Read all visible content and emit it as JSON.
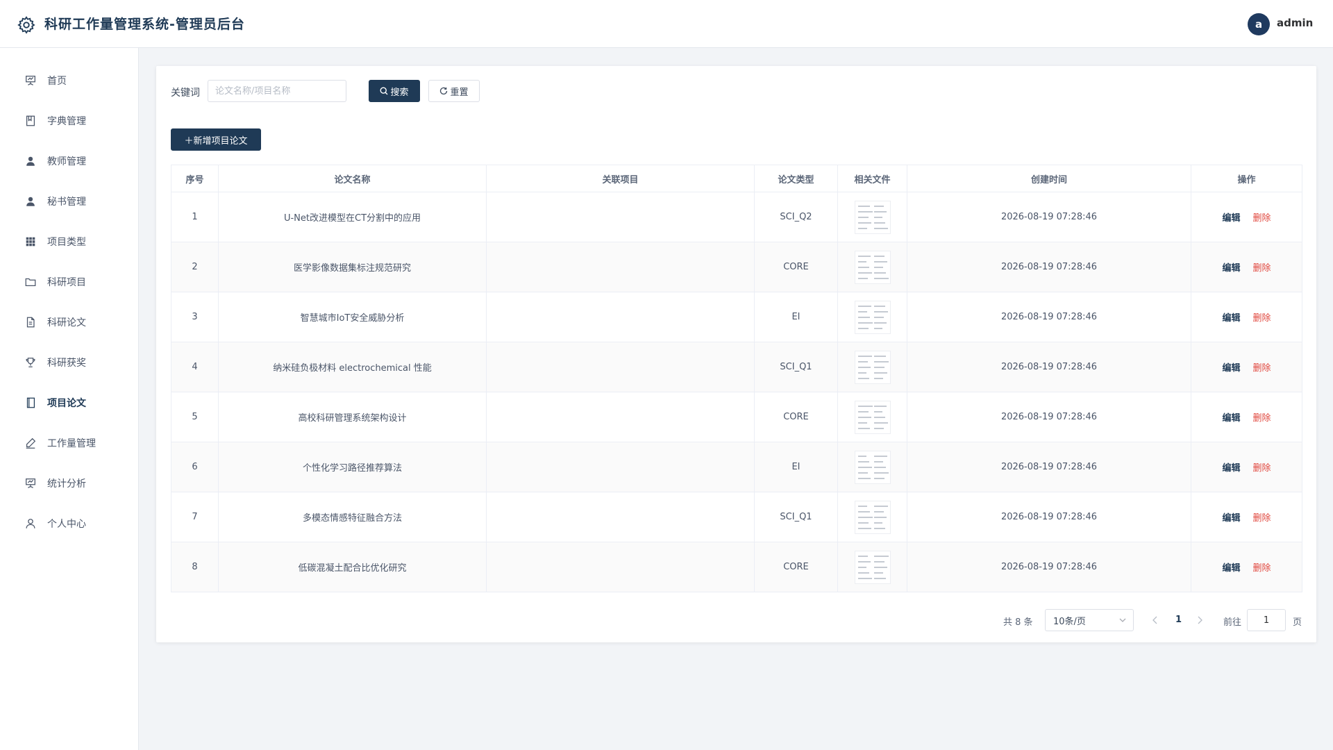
{
  "app": {
    "title": "科研工作量管理系统-管理员后台"
  },
  "user": {
    "avatar_letter": "a",
    "name": "admin"
  },
  "sidebar": {
    "items": [
      {
        "label": "首页",
        "icon": "presentation-icon"
      },
      {
        "label": "字典管理",
        "icon": "book-icon"
      },
      {
        "label": "教师管理",
        "icon": "user-icon"
      },
      {
        "label": "秘书管理",
        "icon": "user-icon"
      },
      {
        "label": "项目类型",
        "icon": "grid-icon"
      },
      {
        "label": "科研项目",
        "icon": "folder-icon"
      },
      {
        "label": "科研论文",
        "icon": "document-icon"
      },
      {
        "label": "科研获奖",
        "icon": "trophy-icon"
      },
      {
        "label": "项目论文",
        "icon": "notebook-icon",
        "active": true
      },
      {
        "label": "工作量管理",
        "icon": "pen-icon"
      },
      {
        "label": "统计分析",
        "icon": "presentation-icon"
      },
      {
        "label": "个人中心",
        "icon": "person-outline-icon"
      }
    ]
  },
  "search": {
    "label": "关键词",
    "placeholder": "论文名称/项目名称",
    "value": "",
    "search_button": "搜索",
    "reset_button": "重置"
  },
  "toolbar": {
    "add_button": "＋新增项目论文"
  },
  "table": {
    "headers": [
      "序号",
      "论文名称",
      "关联项目",
      "论文类型",
      "相关文件",
      "创建时间",
      "操作"
    ],
    "edit_label": "编辑",
    "delete_label": "删除",
    "rows": [
      {
        "index": "1",
        "name": "U-Net改进模型在CT分割中的应用",
        "project": "",
        "type": "SCI_Q2",
        "time": "2026-08-19 07:28:46"
      },
      {
        "index": "2",
        "name": "医学影像数据集标注规范研究",
        "project": "",
        "type": "CORE",
        "time": "2026-08-19 07:28:46"
      },
      {
        "index": "3",
        "name": "智慧城市IoT安全威胁分析",
        "project": "",
        "type": "EI",
        "time": "2026-08-19 07:28:46"
      },
      {
        "index": "4",
        "name": "纳米硅负极材料 electrochemical 性能",
        "project": "",
        "type": "SCI_Q1",
        "time": "2026-08-19 07:28:46"
      },
      {
        "index": "5",
        "name": "高校科研管理系统架构设计",
        "project": "",
        "type": "CORE",
        "time": "2026-08-19 07:28:46"
      },
      {
        "index": "6",
        "name": "个性化学习路径推荐算法",
        "project": "",
        "type": "EI",
        "time": "2026-08-19 07:28:46"
      },
      {
        "index": "7",
        "name": "多模态情感特征融合方法",
        "project": "",
        "type": "SCI_Q1",
        "time": "2026-08-19 07:28:46"
      },
      {
        "index": "8",
        "name": "低碳混凝土配合比优化研究",
        "project": "",
        "type": "CORE",
        "time": "2026-08-19 07:28:46"
      }
    ]
  },
  "pagination": {
    "total_text": "共 8 条",
    "page_size": "10条/页",
    "current_page": "1",
    "goto_label": "前往",
    "goto_value": "1",
    "page_suffix": "页"
  },
  "colors": {
    "primary": "#1f3a56",
    "danger": "#e0463d",
    "background": "#f2f4f7"
  }
}
